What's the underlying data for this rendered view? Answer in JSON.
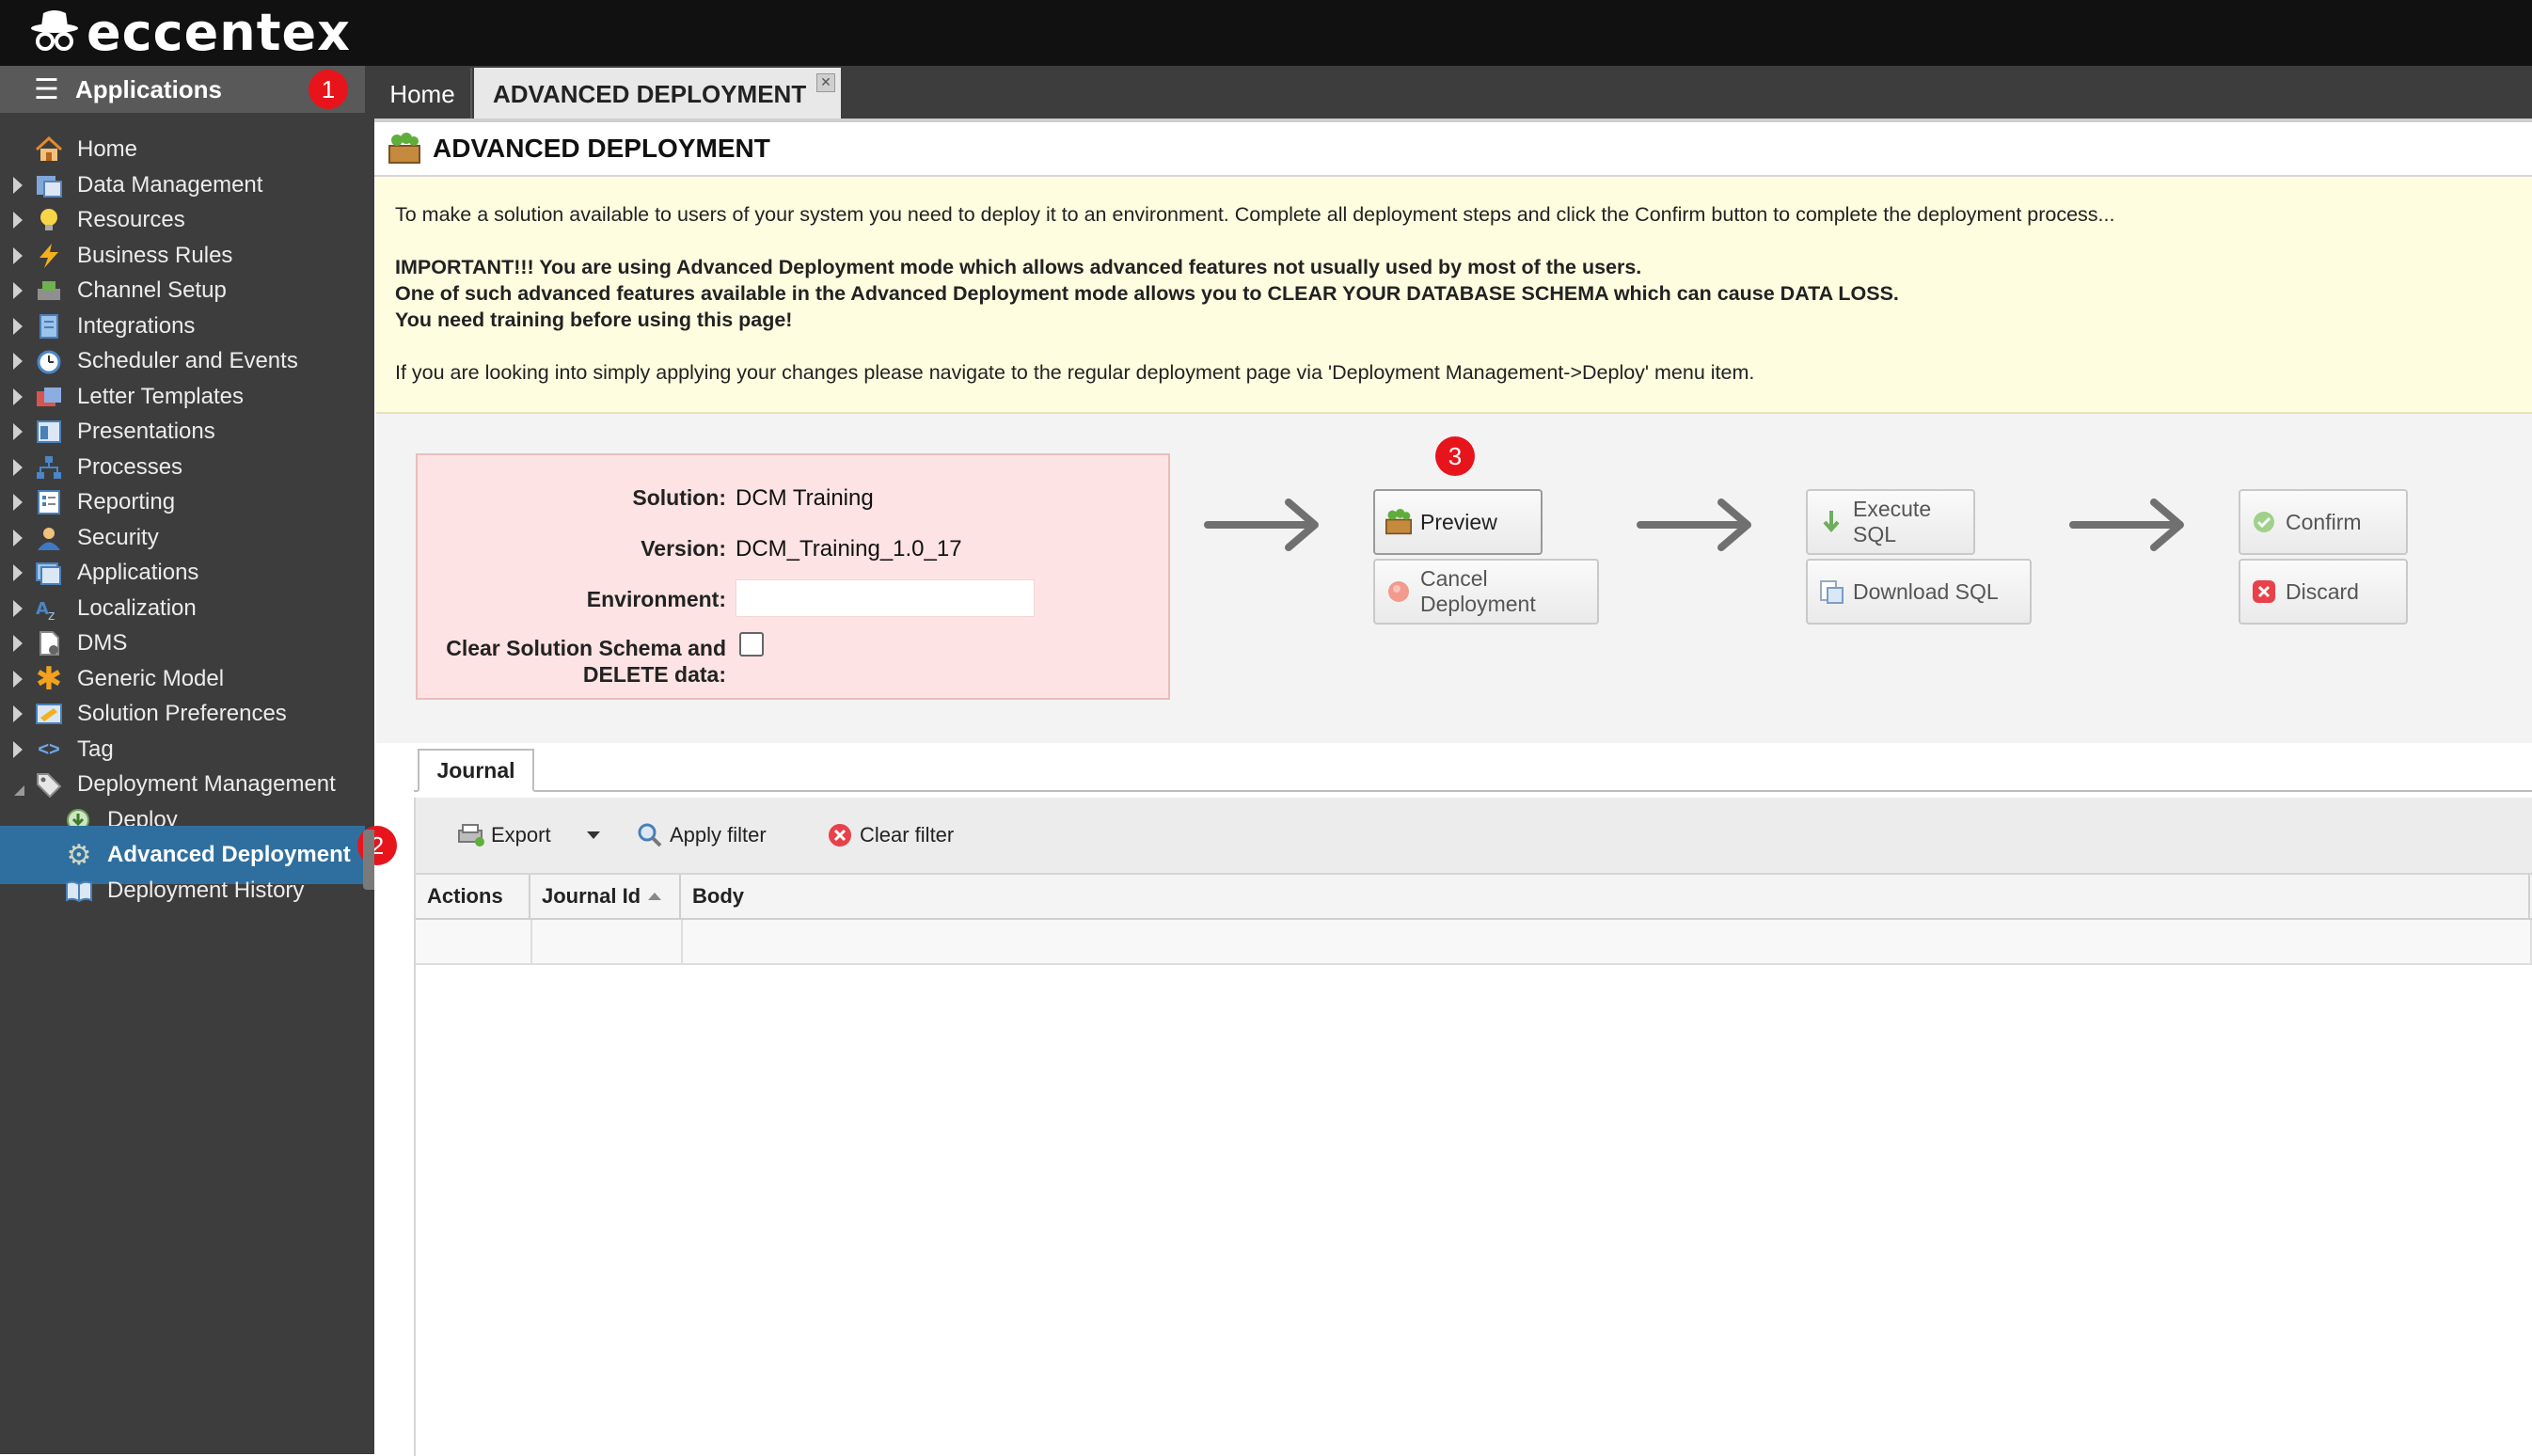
{
  "brand": {
    "name": "eccentex"
  },
  "sidebar": {
    "header": "Applications",
    "items": [
      {
        "label": "Home",
        "icon": "home-icon"
      },
      {
        "label": "Data Management",
        "icon": "data-management-icon"
      },
      {
        "label": "Resources",
        "icon": "resources-icon"
      },
      {
        "label": "Business Rules",
        "icon": "business-rules-icon"
      },
      {
        "label": "Channel Setup",
        "icon": "channel-setup-icon"
      },
      {
        "label": "Integrations",
        "icon": "integrations-icon"
      },
      {
        "label": "Scheduler and Events",
        "icon": "scheduler-icon"
      },
      {
        "label": "Letter Templates",
        "icon": "letter-templates-icon"
      },
      {
        "label": "Presentations",
        "icon": "presentations-icon"
      },
      {
        "label": "Processes",
        "icon": "processes-icon"
      },
      {
        "label": "Reporting",
        "icon": "reporting-icon"
      },
      {
        "label": "Security",
        "icon": "security-icon"
      },
      {
        "label": "Applications",
        "icon": "applications-icon"
      },
      {
        "label": "Localization",
        "icon": "localization-icon"
      },
      {
        "label": "DMS",
        "icon": "dms-icon"
      },
      {
        "label": "Generic Model",
        "icon": "generic-model-icon"
      },
      {
        "label": "Solution Preferences",
        "icon": "solution-preferences-icon"
      },
      {
        "label": "Tag",
        "icon": "tag-icon"
      },
      {
        "label": "Deployment Management",
        "icon": "deployment-management-icon"
      },
      {
        "label": "Deploy",
        "icon": "deploy-icon"
      },
      {
        "label": "Advanced Deployment",
        "icon": "advanced-deployment-icon"
      },
      {
        "label": "Deployment History",
        "icon": "deployment-history-icon"
      }
    ]
  },
  "badges": {
    "one": "1",
    "two": "2",
    "three": "3"
  },
  "tabs": {
    "home": "Home",
    "active": "ADVANCED DEPLOYMENT"
  },
  "page": {
    "title": "ADVANCED DEPLOYMENT"
  },
  "notice": {
    "line1": "To make a solution available to users of your system you need to deploy it to an environment. Complete all deployment steps and click the Confirm button to complete the deployment process...",
    "line2": "IMPORTANT!!! You are using Advanced Deployment mode which allows advanced features not usually used by most of the users.",
    "line3": "One of such advanced features available in the Advanced Deployment mode allows you to CLEAR YOUR DATABASE SCHEMA which can cause DATA LOSS.",
    "line4": "You need training before using this page!",
    "line5": "If you are looking into simply applying your changes please navigate to the regular deployment page via 'Deployment Management->Deploy' menu item."
  },
  "solution_panel": {
    "solution_label": "Solution:",
    "solution_value": "DCM Training",
    "version_label": "Version:",
    "version_value": "DCM_Training_1.0_17",
    "environment_label": "Environment:",
    "environment_value": "",
    "clear_label_line1": "Clear Solution Schema and",
    "clear_label_line2": "DELETE data:",
    "clear_checked": false
  },
  "buttons": {
    "preview": "Preview",
    "cancel": "Cancel Deployment",
    "execute_sql": "Execute SQL",
    "download_sql": "Download SQL",
    "confirm": "Confirm",
    "discard": "Discard"
  },
  "journal": {
    "tab": "Journal",
    "toolbar": {
      "export": "Export",
      "apply_filter": "Apply filter",
      "clear_filter": "Clear filter"
    },
    "columns": [
      "Actions",
      "Journal Id",
      "Body"
    ],
    "rows": []
  },
  "colors": {
    "topbar": "#111111",
    "sidebar": "#3d3d3d",
    "sidebar_active": "#2f6f9f",
    "notice_bg": "#fefde0",
    "solution_panel_bg": "#fde3e3",
    "badge": "#e8141c"
  }
}
